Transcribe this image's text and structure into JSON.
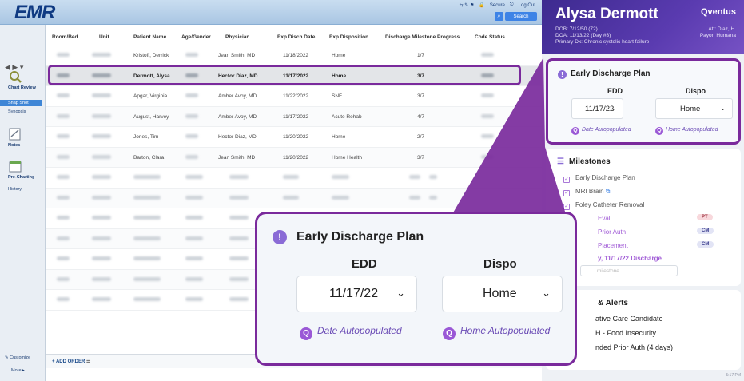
{
  "emr": {
    "logo": "EMR",
    "links": [
      "Secure",
      "Log Out"
    ],
    "search_label": "Search",
    "nav": {
      "chart_review": "Chart Review",
      "snapshot": "Snap Shot",
      "synopsis": "Synopsis",
      "notes": "Notes",
      "pre_charting": "Pre-Charting",
      "history": "History"
    },
    "customize": "Customize",
    "more": "More",
    "add_order": "ADD ORDER",
    "table": {
      "headers": [
        "Room/Bed",
        "Unit",
        "Patient Name",
        "Age/Gender",
        "Physician",
        "Exp Disch Date",
        "Exp Disposition",
        "Discharge Milestone Progress",
        "Code Status"
      ],
      "rows": [
        {
          "patient": "Kristoff, Derrick",
          "physician": "Jean Smith, MD",
          "date": "11/18/2022",
          "dispo": "Home",
          "progress": "1/7"
        },
        {
          "patient": "Dermott, Alysa",
          "physician": "Hector Diaz, MD",
          "date": "11/17/2022",
          "dispo": "Home",
          "progress": "3/7"
        },
        {
          "patient": "Apgar, Virginia",
          "physician": "Amber Avoy, MD",
          "date": "11/22/2022",
          "dispo": "SNF",
          "progress": "3/7"
        },
        {
          "patient": "August, Harvey",
          "physician": "Amber Avoy, MD",
          "date": "11/17/2022",
          "dispo": "Acute Rehab",
          "progress": "4/7"
        },
        {
          "patient": "Jones, Tim",
          "physician": "Hector Diaz, MD",
          "date": "11/20/2022",
          "dispo": "Home",
          "progress": "2/7"
        },
        {
          "patient": "Barton, Clara",
          "physician": "Jean Smith, MD",
          "date": "11/20/2022",
          "dispo": "Home Health",
          "progress": "3/7"
        }
      ]
    }
  },
  "qventus": {
    "brand": "Qventus",
    "patient_name": "Alysa Dermott",
    "dob": "DOB: 7/12/50 (72)",
    "doa": "DOA: 11/13/22 (Day #3)",
    "primary_dx": "Primary Dx: Chronic systolic heart failure",
    "att": "Att: Diaz, H.",
    "payor": "Payor: Humana",
    "discharge_plan": {
      "title": "Early Discharge Plan",
      "edd_label": "EDD",
      "dispo_label": "Dispo",
      "edd_value": "11/17/22",
      "dispo_value": "Home",
      "edd_note": "Date Autopopulated",
      "dispo_note": "Home Autopopulated"
    },
    "milestones": {
      "title": "Milestones",
      "items": [
        "Early Discharge Plan",
        "MRI Brain",
        "Foley Catheter Removal",
        "Eval",
        "Prior Auth",
        "Placement",
        "y, 11/17/22 Discharge"
      ],
      "tags": [
        "PT",
        "CM",
        "CM"
      ],
      "input_placeholder": "milestone"
    },
    "alerts": {
      "title": "& Alerts",
      "items": [
        "ative Care Candidate",
        "H - Food Insecurity",
        "nded Prior Auth (4 days)"
      ]
    },
    "time": "5:17 PM"
  }
}
